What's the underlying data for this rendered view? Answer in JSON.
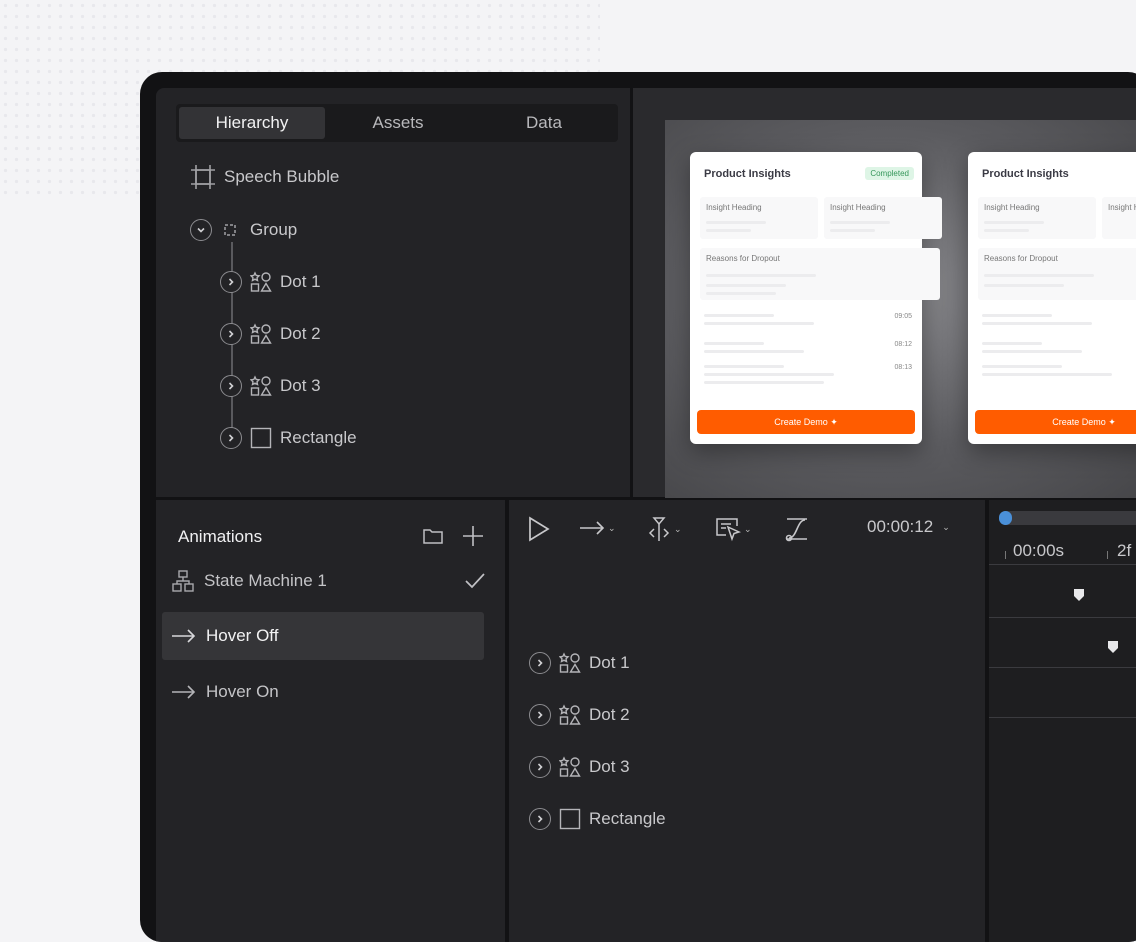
{
  "hierarchy": {
    "tabs": [
      {
        "label": "Hierarchy"
      },
      {
        "label": "Assets"
      },
      {
        "label": "Data"
      }
    ],
    "root": {
      "label": "Speech Bubble",
      "icon": "frame-icon"
    },
    "group": {
      "label": "Group",
      "icon": "group-icon"
    },
    "children": [
      {
        "label": "Dot 1",
        "icon": "shapes-icon"
      },
      {
        "label": "Dot 2",
        "icon": "shapes-icon"
      },
      {
        "label": "Dot 3",
        "icon": "shapes-icon"
      },
      {
        "label": "Rectangle",
        "icon": "rectangle-icon"
      }
    ]
  },
  "stage": {
    "cards": [
      {
        "title": "Product Insights",
        "badge": "Completed",
        "heading1": "Insight Heading",
        "heading2": "Insight Heading",
        "section": "Reasons for Dropout",
        "times": [
          "09:05",
          "08:12",
          "08:13"
        ],
        "button": "Create Demo"
      },
      {
        "title": "Product Insights",
        "heading1": "Insight Heading",
        "heading2": "Insight H",
        "section": "Reasons for Dropout",
        "button": "Create Demo"
      }
    ]
  },
  "animations": {
    "title": "Animations",
    "items": [
      {
        "label": "State Machine 1",
        "icon": "state-machine-icon"
      },
      {
        "label": "Hover Off",
        "icon": "arrow-right-icon"
      },
      {
        "label": "Hover On",
        "icon": "arrow-right-icon"
      }
    ]
  },
  "timeline": {
    "time": "00:00:12",
    "tracks": [
      {
        "label": "Dot 1"
      },
      {
        "label": "Dot 2"
      },
      {
        "label": "Dot 3"
      },
      {
        "label": "Rectangle"
      }
    ],
    "ruler": [
      "00:00s",
      "2f"
    ]
  },
  "colors": {
    "accent": "#ff5c00",
    "scrubber": "#4a90d9",
    "completed": "#35965a"
  }
}
